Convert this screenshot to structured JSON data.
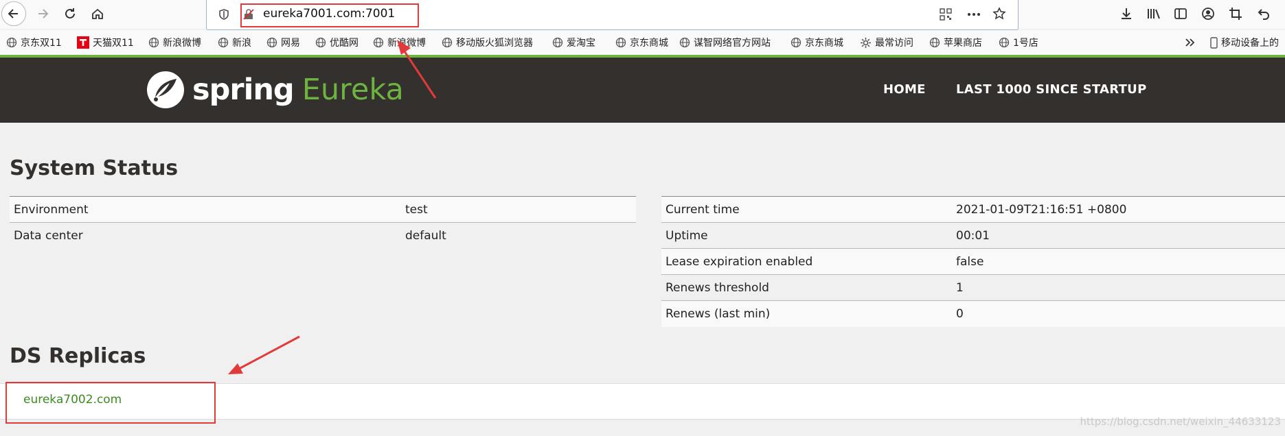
{
  "browser": {
    "url": "eureka7001.com:7001",
    "bookmarks": [
      "京东双11",
      "天猫双11",
      "新浪微博",
      "新浪",
      "网易",
      "优酷网",
      "新浪微博",
      "移动版火狐浏览器",
      "爱淘宝",
      "京东商城",
      "谋智网络官方网站",
      "京东商城",
      "最常访问",
      "苹果商店",
      "1号店"
    ],
    "mobile_bookmarks": "移动设备上的"
  },
  "header": {
    "logo_spring": "spring",
    "logo_eureka": "Eureka",
    "nav": [
      "HOME",
      "LAST 1000 SINCE STARTUP"
    ]
  },
  "system_status": {
    "title": "System Status",
    "left": [
      {
        "label": "Environment",
        "value": "test"
      },
      {
        "label": "Data center",
        "value": "default"
      }
    ],
    "right": [
      {
        "label": "Current time",
        "value": "2021-01-09T21:16:51 +0800"
      },
      {
        "label": "Uptime",
        "value": "00:01"
      },
      {
        "label": "Lease expiration enabled",
        "value": "false"
      },
      {
        "label": "Renews threshold",
        "value": "1"
      },
      {
        "label": "Renews (last min)",
        "value": "0"
      }
    ]
  },
  "ds_replicas": {
    "title": "DS Replicas",
    "items": [
      "eureka7002.com"
    ]
  },
  "watermark": "https://blog.csdn.net/weixin_44633123",
  "colors": {
    "brand_green": "#6db33f",
    "header_bg": "#34302d",
    "annotation_red": "#e23a3a"
  }
}
